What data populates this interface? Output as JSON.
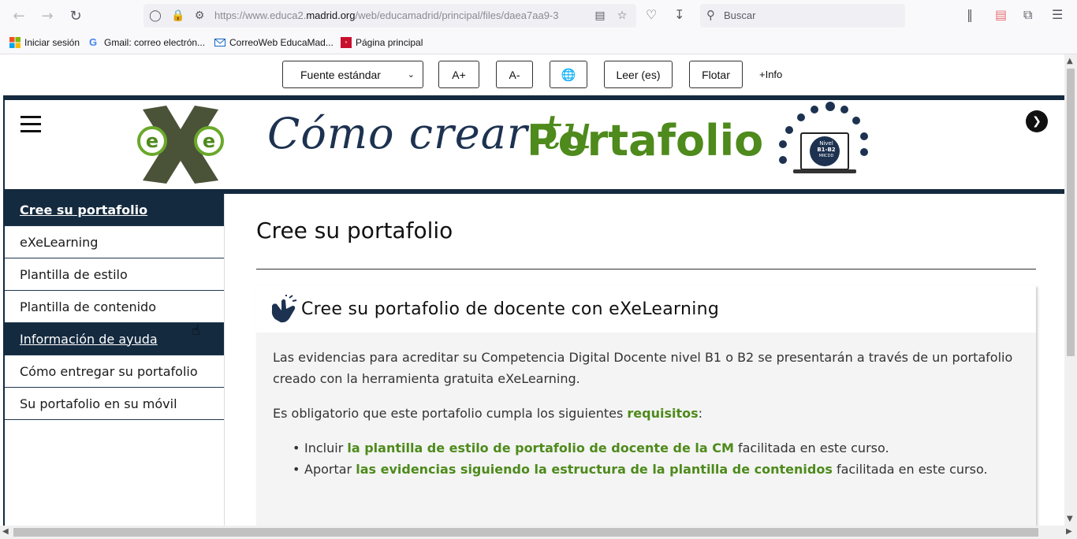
{
  "browser": {
    "url_prefix": "https://www.educa2.",
    "url_domain": "madrid.org",
    "url_suffix": "/web/educamadrid/principal/files/daea7aa9-3",
    "search_placeholder": "Buscar"
  },
  "bookmarks": [
    {
      "label": "Iniciar sesión",
      "icon": "windows-icon"
    },
    {
      "label": "Gmail: correo electrón...",
      "icon": "google-icon"
    },
    {
      "label": "CorreoWeb EducaMad...",
      "icon": "mail-icon"
    },
    {
      "label": "Página principal",
      "icon": "madrid-icon"
    }
  ],
  "a11y": {
    "font_select": "Fuente estándar",
    "increase": "A+",
    "decrease": "A-",
    "read": "Leer (es)",
    "float": "Flotar",
    "more_info": "+Info"
  },
  "banner": {
    "script_text": "Cómo crear",
    "script_tu": "tu",
    "main_text": "Portafolio",
    "badge_line1": "Nivel",
    "badge_line2": "B1-B2",
    "badge_line3": "MRCDD"
  },
  "sidebar": {
    "items": [
      {
        "label": "Cree su portafolio",
        "state": "current"
      },
      {
        "label": "eXeLearning",
        "state": "normal"
      },
      {
        "label": "Plantilla de estilo",
        "state": "normal"
      },
      {
        "label": "Plantilla de contenido",
        "state": "normal"
      },
      {
        "label": "Información de ayuda",
        "state": "hover"
      },
      {
        "label": "Cómo entregar su portafolio",
        "state": "normal"
      },
      {
        "label": "Su portafolio en su móvil",
        "state": "normal"
      }
    ]
  },
  "main": {
    "title": "Cree su portafolio",
    "box_title": "Cree su portafolio de docente con eXeLearning",
    "p1": "Las evidencias para acreditar su Competencia Digital Docente nivel B1 o B2 se presentarán a través de un portafolio creado con la herramienta gratuita eXeLearning.",
    "p2_pre": "Es obligatorio que este portafolio cumpla los siguientes ",
    "p2_bold": "requisitos",
    "p2_post": ":",
    "li1_pre": "Incluir ",
    "li1_bold": "la plantilla de estilo de portafolio de docente de la CM",
    "li1_post": " facilitada en este curso.",
    "li2_pre": "Aportar ",
    "li2_bold": "las evidencias siguiendo la estructura de la plantilla de contenidos",
    "li2_post": " facilitada en este curso."
  },
  "colors": {
    "navy": "#142a3f",
    "green": "#4e8a1c"
  }
}
